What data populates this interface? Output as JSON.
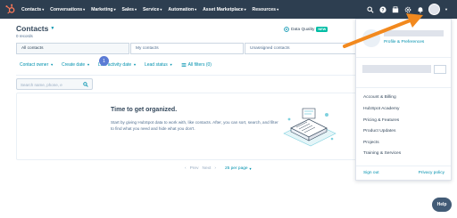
{
  "nav": {
    "items": [
      {
        "label": "Contacts",
        "name": "nav-contacts"
      },
      {
        "label": "Conversations",
        "name": "nav-conversations"
      },
      {
        "label": "Marketing",
        "name": "nav-marketing"
      },
      {
        "label": "Sales",
        "name": "nav-sales"
      },
      {
        "label": "Service",
        "name": "nav-service"
      },
      {
        "label": "Automation",
        "name": "nav-automation"
      },
      {
        "label": "Asset Marketplace",
        "name": "nav-asset-marketplace"
      },
      {
        "label": "Resources",
        "name": "nav-resources"
      }
    ],
    "icons": [
      "search-icon",
      "help-icon",
      "marketplace-icon",
      "settings-icon",
      "notifications-icon"
    ]
  },
  "page": {
    "title": "Contacts",
    "records": "0 records",
    "data_quality": "Data Quality",
    "new_badge": "NEW"
  },
  "tabs": [
    {
      "label": "All contacts",
      "active": true
    },
    {
      "label": "My contacts",
      "active": false
    },
    {
      "label": "Unassigned contacts",
      "active": false
    }
  ],
  "filters": {
    "contact_owner": "Contact owner",
    "create_date": "Create date",
    "last_activity": "Last activity date",
    "lead_status": "Lead status",
    "all_filters": "All filters (0)",
    "step_badge": "1"
  },
  "search": {
    "placeholder": "Search name, phone, e"
  },
  "empty_state": {
    "title": "Time to get organized.",
    "text": "Start by giving HubSpot data to work with, like contacts. After, you can sort, search, and filter to find what you need and hide what you don't."
  },
  "pagination": {
    "prev": "Prev",
    "next": "Next",
    "per_page": "25 per page"
  },
  "dropdown": {
    "profile_link": "Profile & Preferences",
    "items": [
      "Account & Billing",
      "HubSpot Academy",
      "Pricing & Features",
      "Product Updates",
      "Projects",
      "Training & Services"
    ],
    "sign_out": "Sign out",
    "privacy": "Privacy policy"
  },
  "help": "Help",
  "colors": {
    "nav_bg": "#2d3e50",
    "link": "#0091ae",
    "arrow": "#f2891e",
    "new_badge": "#00bda5"
  }
}
